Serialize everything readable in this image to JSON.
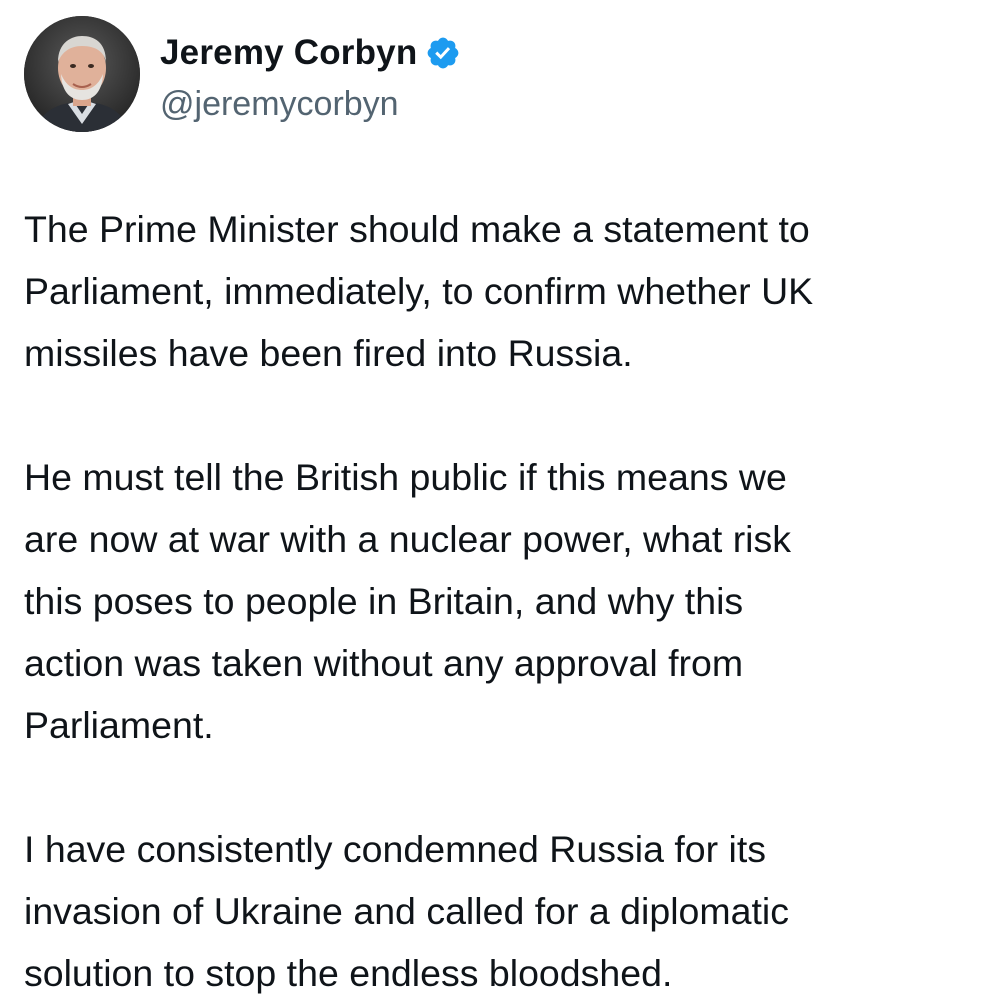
{
  "author": {
    "display_name": "Jeremy Corbyn",
    "handle": "@jeremycorbyn",
    "verified": true,
    "avatar_icon": "profile-photo",
    "verified_icon": "verified-badge-icon",
    "verified_color": "#1d9bf0"
  },
  "tweet": {
    "paragraphs": [
      "The Prime Minister should make a statement to\nParliament, immediately, to confirm whether UK\nmissiles have been fired into Russia.",
      "He must tell the British public if this means we\nare now at war with a nuclear power, what risk\nthis poses to people in Britain, and why this\naction was taken without any approval from\nParliament.",
      "I have consistently condemned Russia for its\ninvasion of Ukraine and called for a diplomatic\nsolution to stop the endless bloodshed."
    ]
  },
  "colors": {
    "text_primary": "#0f1419",
    "text_secondary": "#536471",
    "background": "#ffffff"
  }
}
